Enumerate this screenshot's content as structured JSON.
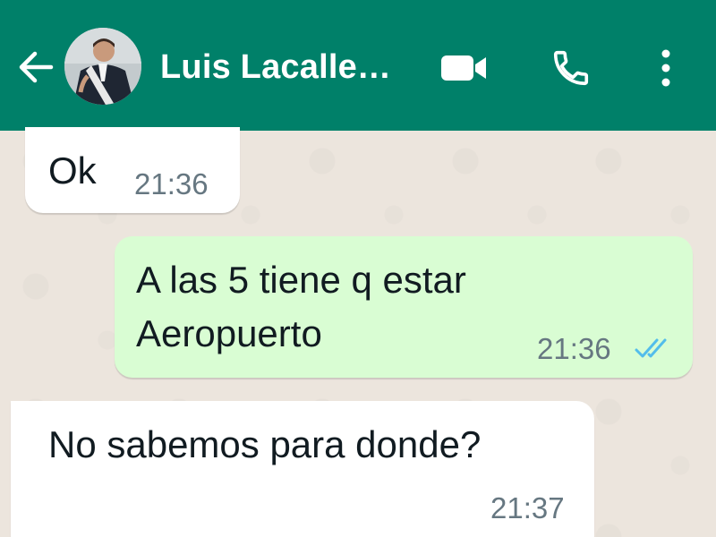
{
  "header": {
    "contact_name": "Luis Lacalle…",
    "back_icon": "back-arrow-icon",
    "video_icon": "video-camera-icon",
    "call_icon": "phone-icon",
    "menu_icon": "more-vertical-icon",
    "bg_color": "#008069"
  },
  "messages": [
    {
      "direction": "incoming",
      "text": "Ok",
      "time": "21:36"
    },
    {
      "direction": "outgoing",
      "text_line1": "A las 5 tiene q estar",
      "text_line2": "Aeropuerto",
      "time": "21:36",
      "status": "read",
      "status_icon": "double-check-icon"
    },
    {
      "direction": "incoming",
      "text": "No sabemos para donde?",
      "time": "21:37"
    }
  ],
  "colors": {
    "incoming_bubble": "#ffffff",
    "outgoing_bubble": "#d9fdd3",
    "read_ticks": "#53bdeb",
    "background": "#ece5dd"
  }
}
